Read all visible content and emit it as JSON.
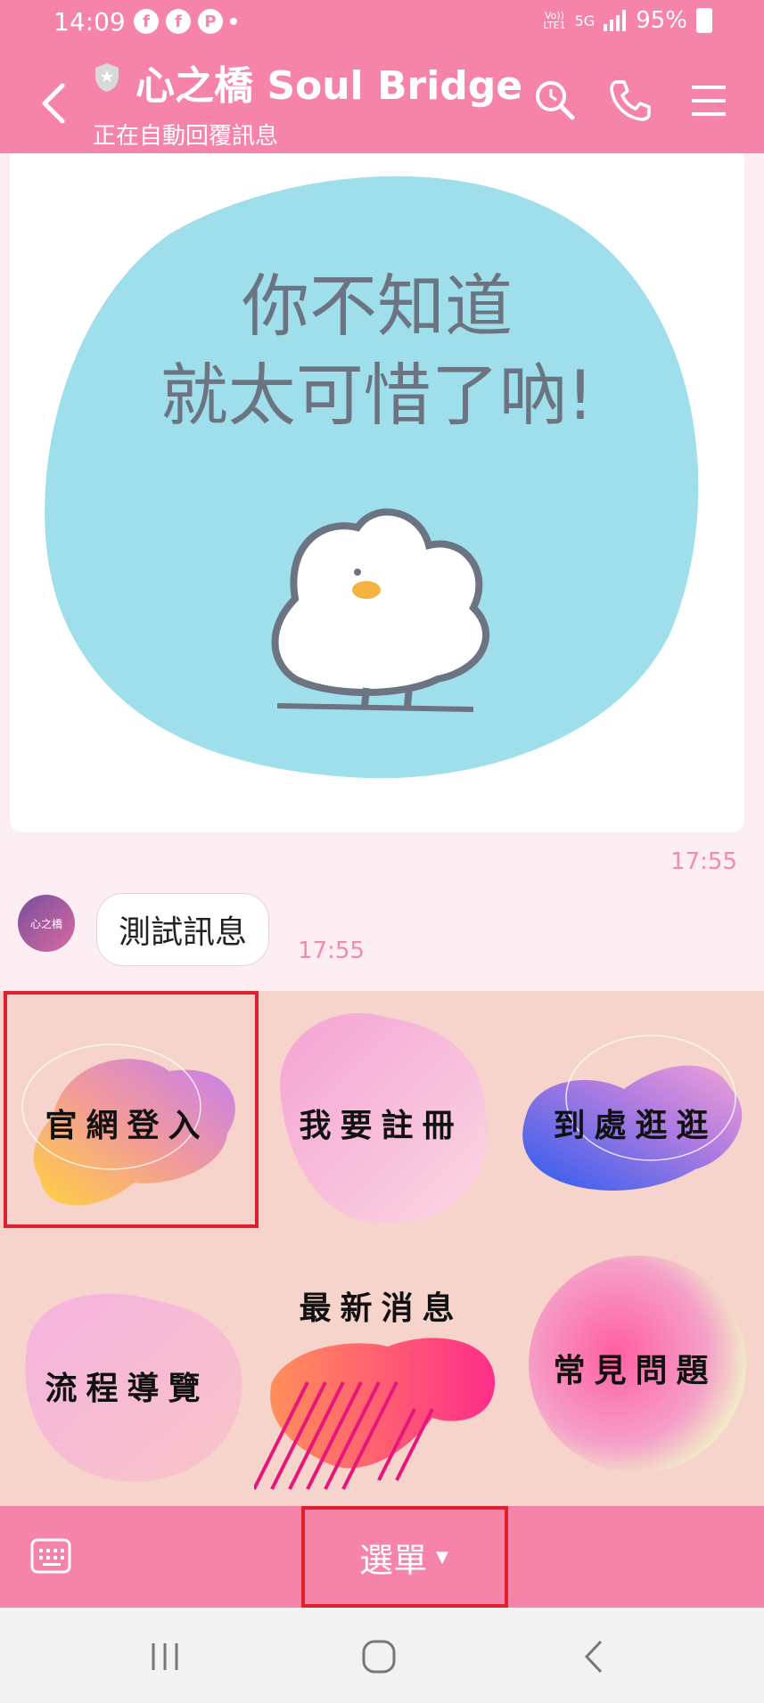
{
  "status": {
    "time": "14:09",
    "network_top": "Vo))",
    "network_bottom": "LTE1",
    "network_type": "5G",
    "battery": "95%"
  },
  "header": {
    "title": "心之橋 Soul Bridge",
    "subtitle": "正在自動回覆訊息"
  },
  "chat": {
    "sticker": {
      "line1": "你不知道",
      "line2": "就太可惜了吶!"
    },
    "sticker_time": "17:55",
    "avatar_text": "心之橋",
    "message": "測試訊息",
    "message_time": "17:55"
  },
  "rich_menu": {
    "items": [
      {
        "label": "官網登入"
      },
      {
        "label": "我要註冊"
      },
      {
        "label": "到處逛逛"
      },
      {
        "label": "流程導覽"
      },
      {
        "label": "最新消息"
      },
      {
        "label": "常見問題"
      }
    ]
  },
  "bottom": {
    "menu_label": "選單"
  },
  "colors": {
    "accent": "#f584a8",
    "sticker_bg": "#9edfeb",
    "menu_bg": "#f6d4cc",
    "highlight": "#e0202f"
  }
}
